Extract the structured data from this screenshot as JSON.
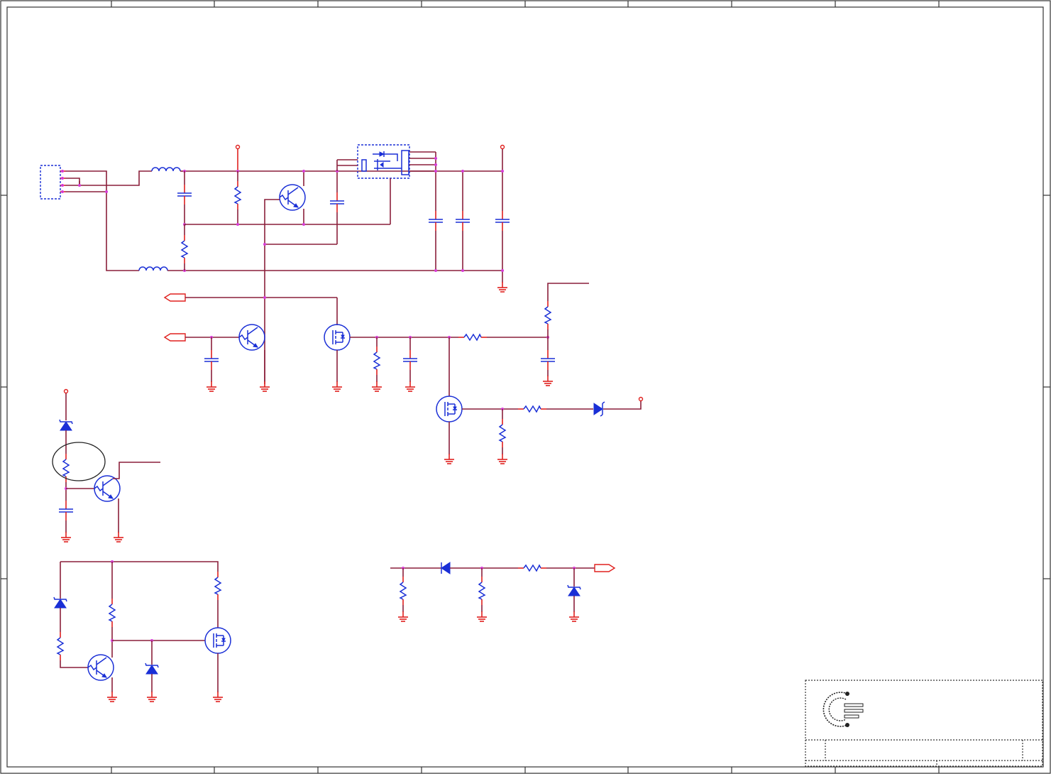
{
  "sheet": {
    "title": "",
    "colors": {
      "wire": "#8a1f3a",
      "pin": "#e0201e",
      "part": "#1a2fd6",
      "junction": "#d63bd6",
      "border": "#333333",
      "annotation": "#222222"
    }
  },
  "title_block": {
    "logo_icon": "company-logo-icon",
    "fields": [
      "",
      "",
      ""
    ]
  },
  "components": [
    {
      "kind": "connector",
      "icon": "connector-header-icon"
    },
    {
      "kind": "inductor",
      "icon": "inductor-icon",
      "count": 2
    },
    {
      "kind": "resistor",
      "icon": "resistor-icon",
      "count": 16
    },
    {
      "kind": "capacitor",
      "icon": "capacitor-icon",
      "count": 10
    },
    {
      "kind": "npn-transistor",
      "icon": "npn-transistor-icon",
      "count": 4
    },
    {
      "kind": "mosfet",
      "icon": "mosfet-icon",
      "count": 3
    },
    {
      "kind": "diode",
      "icon": "diode-icon",
      "count": 3
    },
    {
      "kind": "zener-diode",
      "icon": "zener-diode-icon",
      "count": 4
    },
    {
      "kind": "power-switch-ic",
      "icon": "ic-package-icon",
      "count": 1
    },
    {
      "kind": "ground",
      "icon": "ground-icon",
      "count": 17
    },
    {
      "kind": "power-rail",
      "icon": "power-rail-icon",
      "count": 4
    },
    {
      "kind": "port-off-page",
      "icon": "port-arrow-icon",
      "count": 3
    }
  ]
}
